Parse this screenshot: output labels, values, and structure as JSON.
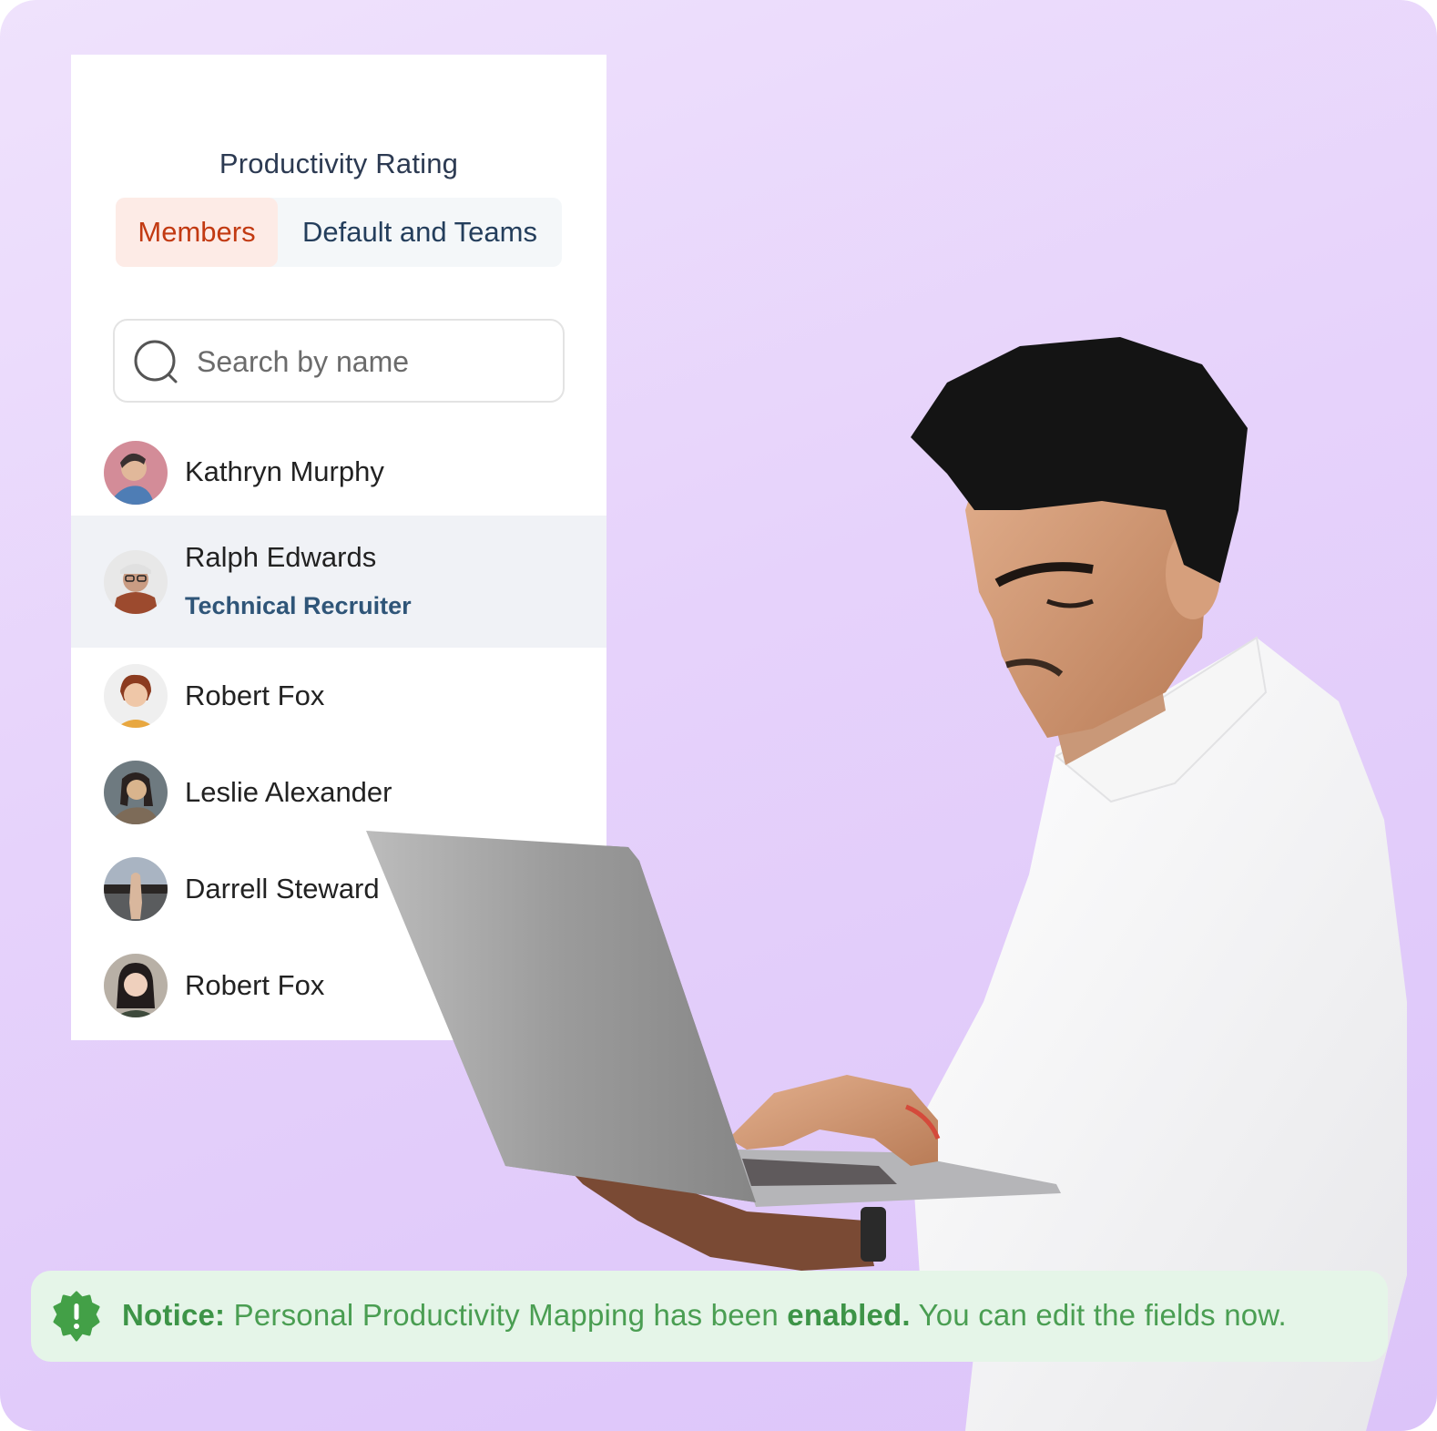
{
  "card": {
    "title": "Productivity Rating",
    "tabs": [
      {
        "label": "Members",
        "active": true
      },
      {
        "label": "Default and Teams",
        "active": false
      }
    ],
    "search": {
      "placeholder": "Search by name",
      "value": ""
    },
    "members": [
      {
        "name": "Kathryn Murphy",
        "role": null,
        "selected": false,
        "avatar_colors": [
          "#d38c98",
          "#3a3030",
          "#e1b89a",
          "#4e7db5"
        ]
      },
      {
        "name": "Ralph Edwards",
        "role": "Technical Recruiter",
        "selected": true,
        "avatar_colors": [
          "#e8e8e8",
          "#9c4a2e",
          "#c99c83",
          "#e0e0e0"
        ]
      },
      {
        "name": "Robert Fox",
        "role": null,
        "selected": false,
        "avatar_colors": [
          "#efefef",
          "#8c3b1f",
          "#efc7a8",
          "#e8a740"
        ]
      },
      {
        "name": "Leslie Alexander",
        "role": null,
        "selected": false,
        "avatar_colors": [
          "#6e7a80",
          "#2a2220",
          "#d9b48d",
          "#7d6b58"
        ]
      },
      {
        "name": "Darrell Steward",
        "role": null,
        "selected": false,
        "avatar_colors": [
          "#a9b4c2",
          "#d9b79d",
          "#2a2624",
          "#5a5c5e"
        ]
      },
      {
        "name": "Robert Fox",
        "role": null,
        "selected": false,
        "avatar_colors": [
          "#b8b0a6",
          "#221c1c",
          "#efd0bd",
          "#3e4a3c"
        ]
      }
    ]
  },
  "notice": {
    "label": "Notice:",
    "text_before": " Personal Productivity Mapping has been ",
    "emphasis": "enabled.",
    "text_after": " You can edit the fields now.",
    "icon": "alert-badge-icon",
    "color": "#43a047"
  },
  "colors": {
    "background_top": "#efe2fc",
    "background_bottom": "#dcc4f9",
    "tab_active_bg": "#fdebe6",
    "tab_active_text": "#c23a12",
    "tab_inactive_text": "#243e5c",
    "selected_row_bg": "#f0f2f6",
    "role_text": "#2f5578",
    "notice_bg": "#e5f5e8"
  }
}
